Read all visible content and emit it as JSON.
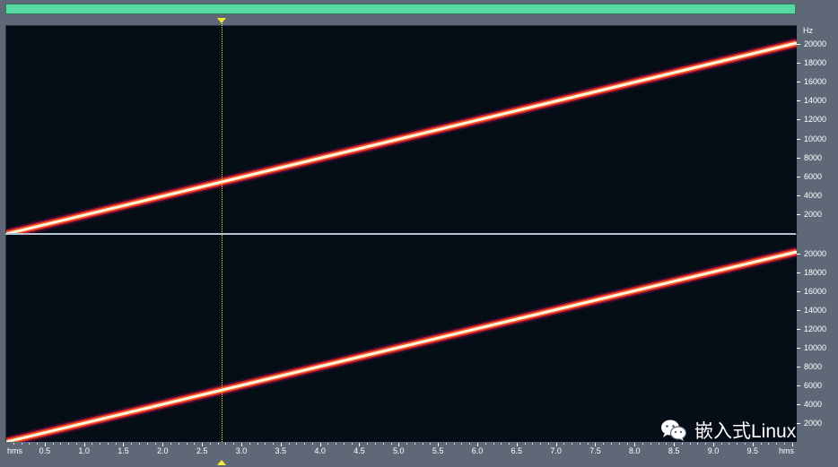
{
  "window": {
    "overview_bar_color": "#58d9a2",
    "cursor_time_s": 2.75
  },
  "channels": [
    {
      "id": "channel-1"
    },
    {
      "id": "channel-2"
    }
  ],
  "freq_axis": {
    "unit": "Hz",
    "ticks": [
      "20000",
      "18000",
      "16000",
      "14000",
      "12000",
      "10000",
      "8000",
      "6000",
      "4000",
      "2000"
    ]
  },
  "time_axis": {
    "unit_left": "hms",
    "unit_right": "hms",
    "ticks": [
      "0.5",
      "1.0",
      "1.5",
      "2.0",
      "2.5",
      "3.0",
      "3.5",
      "4.0",
      "4.5",
      "5.0",
      "5.5",
      "6.0",
      "6.5",
      "7.0",
      "7.5",
      "8.0",
      "8.5",
      "9.0",
      "9.5"
    ]
  },
  "chart_data": {
    "type": "line",
    "title": "",
    "xlabel": "hms",
    "ylabel": "Hz",
    "xlim": [
      0,
      10.05
    ],
    "ylim": [
      0,
      22000
    ],
    "series": [
      {
        "x": [
          0,
          10.05
        ],
        "values": [
          0,
          20200
        ]
      }
    ],
    "colors": {
      "background": "#050d16",
      "sweep_core": "#fff7dc",
      "sweep_glow": "#ff5a2a"
    }
  },
  "watermark": {
    "icon": "wechat-icon",
    "text": "嵌入式Linux"
  }
}
